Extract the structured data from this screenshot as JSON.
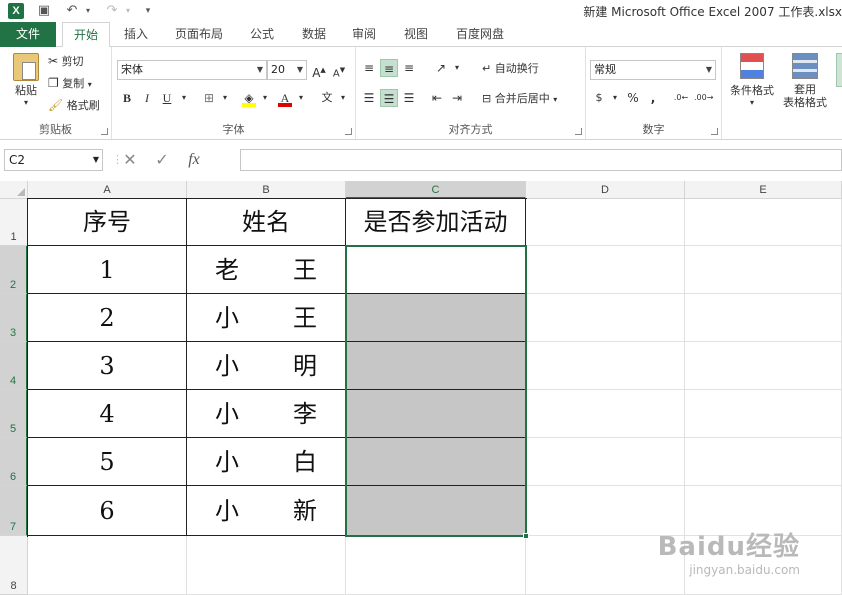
{
  "window": {
    "title": "新建 Microsoft Office Excel 2007 工作表.xlsx"
  },
  "tabs": [
    "文件",
    "开始",
    "插入",
    "页面布局",
    "公式",
    "数据",
    "审阅",
    "视图",
    "百度网盘"
  ],
  "ribbon": {
    "clipboard": {
      "label": "剪贴板",
      "paste": "粘贴",
      "cut": "剪切",
      "copy": "复制",
      "format_painter": "格式刷"
    },
    "font": {
      "label": "字体",
      "font_name": "宋体",
      "font_size": "20",
      "bold": "B",
      "italic": "I",
      "underline": "U"
    },
    "alignment": {
      "label": "对齐方式",
      "wrap_text": "自动换行",
      "merge_center": "合并后居中"
    },
    "number": {
      "label": "数字",
      "format": "常规",
      "percent": "%",
      "comma": ","
    },
    "styles": {
      "conditional_format": "条件格式",
      "table_format_line1": "套用",
      "table_format_line2": "表格格式"
    }
  },
  "formula_bar": {
    "name_box": "C2",
    "cancel": "✕",
    "enter": "✓",
    "fx": "fx",
    "value": ""
  },
  "grid": {
    "columns": [
      "A",
      "B",
      "C",
      "D",
      "E"
    ],
    "rows": [
      "1",
      "2",
      "3",
      "4",
      "5",
      "6",
      "7",
      "8"
    ],
    "headers": [
      "序号",
      "姓名",
      "是否参加活动"
    ],
    "records": [
      {
        "no": "1",
        "name_a": "老",
        "name_b": "王"
      },
      {
        "no": "2",
        "name_a": "小",
        "name_b": "王"
      },
      {
        "no": "3",
        "name_a": "小",
        "name_b": "明"
      },
      {
        "no": "4",
        "name_a": "小",
        "name_b": "李"
      },
      {
        "no": "5",
        "name_a": "小",
        "name_b": "白"
      },
      {
        "no": "6",
        "name_a": "小",
        "name_b": "新"
      }
    ],
    "selection_color": "#217346",
    "fill_color": "#c6c6c6"
  },
  "watermark": {
    "line1": "Baidu经验",
    "line2": "jingyan.baidu.com"
  }
}
